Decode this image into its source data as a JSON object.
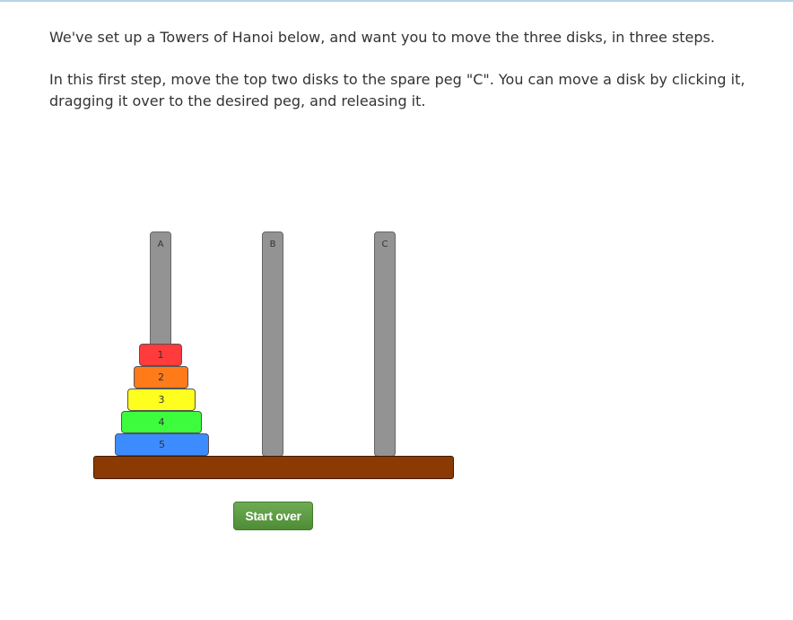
{
  "instructions": {
    "paragraph1": "We've set up a Towers of Hanoi below, and want you to move the three disks, in three steps.",
    "paragraph2": "In this first step, move the top two disks to the spare peg \"C\". You can move a disk by clicking it, dragging it over to the desired peg, and releasing it."
  },
  "pegs": [
    {
      "label": "A"
    },
    {
      "label": "B"
    },
    {
      "label": "C"
    }
  ],
  "disks": [
    {
      "label": "1",
      "color": "#ff3b3b",
      "peg": "A"
    },
    {
      "label": "2",
      "color": "#ff7b1a",
      "peg": "A"
    },
    {
      "label": "3",
      "color": "#ffff1f",
      "peg": "A"
    },
    {
      "label": "4",
      "color": "#3dfc3d",
      "peg": "A"
    },
    {
      "label": "5",
      "color": "#3d8cff",
      "peg": "A"
    }
  ],
  "colors": {
    "peg": "#939393",
    "base": "#8b3a04",
    "button": "#5a9a40"
  },
  "controls": {
    "start_over_label": "Start over"
  }
}
